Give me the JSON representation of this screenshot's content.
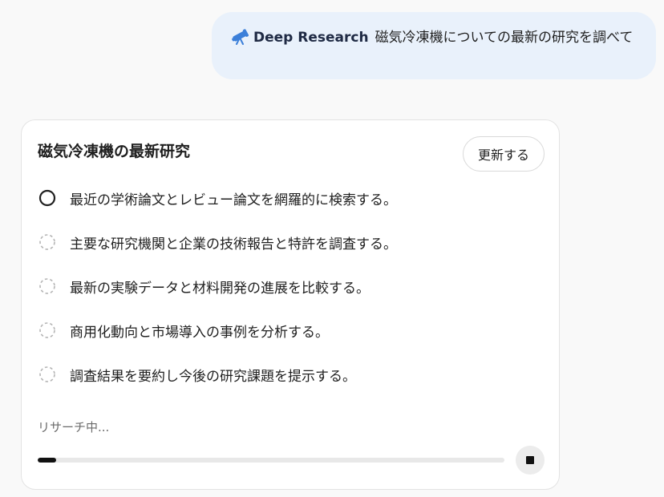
{
  "prompt": {
    "tag": "Deep Research",
    "text": "磁気冷凍機についての最新の研究を調べて",
    "icon": "telescope-icon"
  },
  "research": {
    "title": "磁気冷凍機の最新研究",
    "update_label": "更新する",
    "steps": [
      {
        "label": "最近の学術論文とレビュー論文を網羅的に検索する。",
        "state": "in-progress"
      },
      {
        "label": "主要な研究機関と企業の技術報告と特許を調査する。",
        "state": "pending"
      },
      {
        "label": "最新の実験データと材料開発の進展を比較する。",
        "state": "pending"
      },
      {
        "label": "商用化動向と市場導入の事例を分析する。",
        "state": "pending"
      },
      {
        "label": "調査結果を要約し今後の研究課題を提示する。",
        "state": "pending"
      }
    ],
    "status": "リサーチ中...",
    "progress": 0.04,
    "stop_icon": "stop-icon"
  },
  "colors": {
    "bubble_bg": "#e9f1fb",
    "accent_icon": "#3b7fd9",
    "progress_fill": "#111111"
  }
}
